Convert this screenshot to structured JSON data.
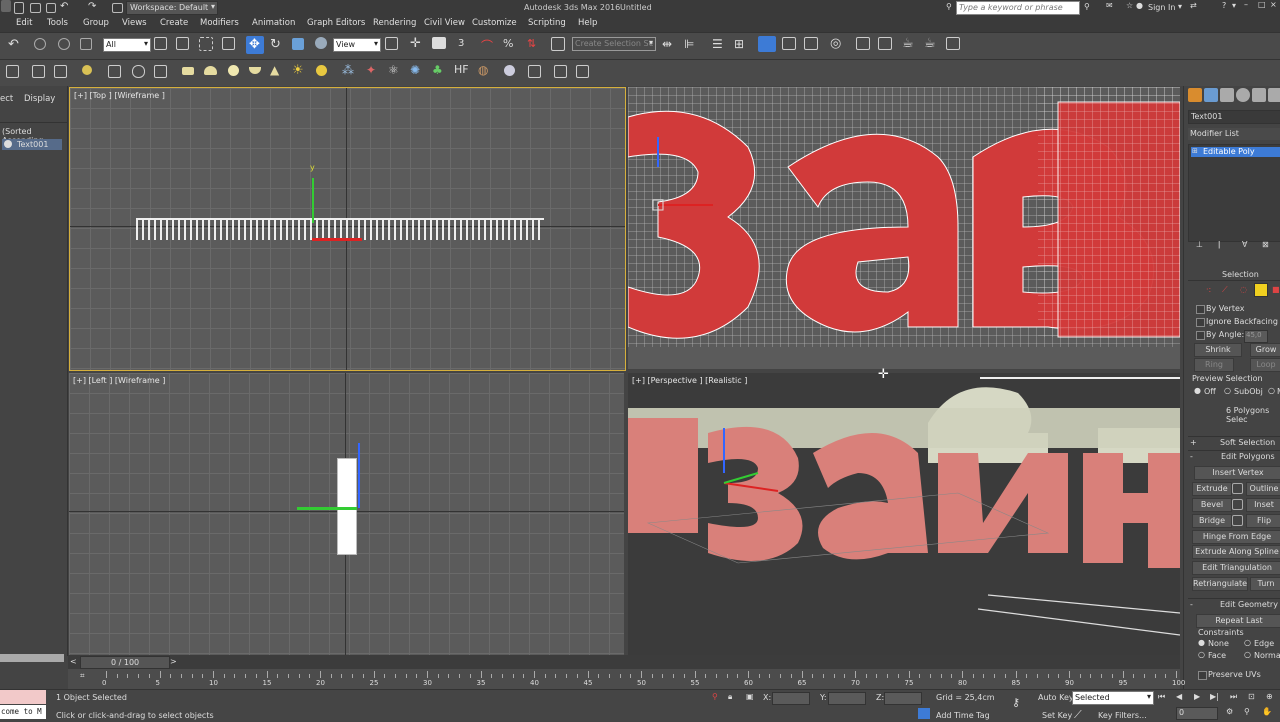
{
  "titlebar": {
    "workspace": "Workspace: Default",
    "app_title": "Autodesk 3ds Max 2016",
    "doc_title": "Untitled",
    "search_placeholder": "Type a keyword or phrase",
    "sign_in": "Sign In"
  },
  "menus": [
    "Edit",
    "Tools",
    "Group",
    "Views",
    "Create",
    "Modifiers",
    "Animation",
    "Graph Editors",
    "Rendering",
    "Civil View",
    "Customize",
    "Scripting",
    "Help"
  ],
  "toolbar": {
    "selection_filter": "All",
    "ref_coord": "View",
    "selection_set": "Create Selection Se"
  },
  "left_panel": {
    "tab_select": "ect",
    "tab_display": "Display",
    "sort": "(Sorted Ascending",
    "item": "Text001"
  },
  "viewports": {
    "top": "[+] [Top ] [Wireframe ]",
    "left": "[+] [Left ] [Wireframe ]",
    "perspective": "[+] [Perspective ] [Realistic ]"
  },
  "right_panel": {
    "object_name": "Text001",
    "modifier_list": "Modifier List",
    "modifier_stack_item": "Editable Poly",
    "selection_header": "Selection",
    "by_vertex": "By Vertex",
    "ignore_backfacing": "Ignore Backfacing",
    "by_angle": "By Angle:",
    "by_angle_value": "45,0",
    "shrink": "Shrink",
    "grow": "Grow",
    "ring": "Ring",
    "loop": "Loop",
    "preview_selection": "Preview Selection",
    "off": "Off",
    "subobj": "SubObj",
    "multi": "M",
    "polys_selected": "6 Polygons Selec",
    "soft_selection": "Soft Selection",
    "edit_polygons": "Edit Polygons",
    "insert_vertex": "Insert Vertex",
    "extrude": "Extrude",
    "outline": "Outline",
    "bevel": "Bevel",
    "inset": "Inset",
    "bridge": "Bridge",
    "flip": "Flip",
    "hinge_from_edge": "Hinge From Edge",
    "extrude_along_spline": "Extrude Along Spline",
    "edit_triangulation": "Edit Triangulation",
    "retriangulate": "Retriangulate",
    "turn": "Turn",
    "edit_geometry": "Edit Geometry",
    "repeat_last": "Repeat Last",
    "constraints": "Constraints",
    "c_none": "None",
    "c_edge": "Edge",
    "c_face": "Face",
    "c_normal": "Normal",
    "preserve_uvs": "Preserve UVs"
  },
  "timeline": {
    "frame": "0 / 100",
    "ticks": [
      "0",
      "5",
      "10",
      "15",
      "20",
      "25",
      "30",
      "35",
      "40",
      "45",
      "50",
      "55",
      "60",
      "65",
      "70",
      "75",
      "80",
      "85",
      "90",
      "95",
      "100"
    ]
  },
  "status": {
    "script_listener": "come to M",
    "objects_selected": "1 Object Selected",
    "prompt": "Click or click-and-drag to select objects",
    "x_label": "X:",
    "y_label": "Y:",
    "z_label": "Z:",
    "grid": "Grid = 25,4cm",
    "add_time_tag": "Add Time Tag",
    "auto_key": "Auto Key",
    "auto_key_mode": "Selected",
    "set_key": "Set Key",
    "key_filters": "Key Filters...",
    "current_frame": "0"
  },
  "colors": {
    "accent": "#3d7bd6",
    "text_red": "#d13a3a",
    "text_pink": "#d9807a",
    "text_cream": "#d6d8c4",
    "active_viewport": "#d6b03c"
  }
}
